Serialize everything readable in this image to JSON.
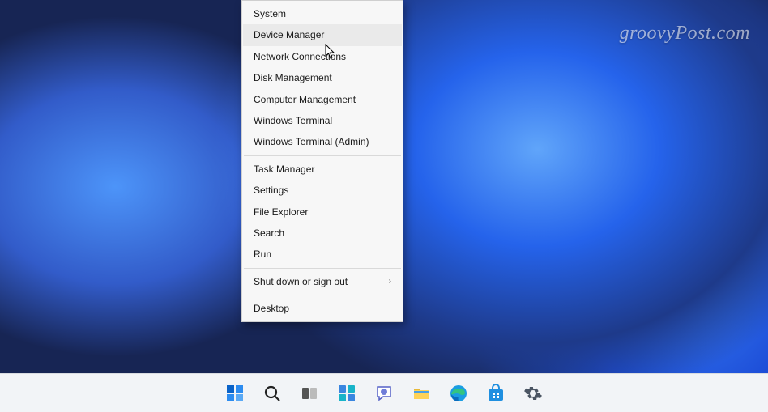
{
  "watermark": "groovyPost.com",
  "contextMenu": {
    "hoveredIndex": 1,
    "groups": [
      [
        {
          "label": "System",
          "submenu": false
        },
        {
          "label": "Device Manager",
          "submenu": false
        },
        {
          "label": "Network Connections",
          "submenu": false
        },
        {
          "label": "Disk Management",
          "submenu": false
        },
        {
          "label": "Computer Management",
          "submenu": false
        },
        {
          "label": "Windows Terminal",
          "submenu": false
        },
        {
          "label": "Windows Terminal (Admin)",
          "submenu": false
        }
      ],
      [
        {
          "label": "Task Manager",
          "submenu": false
        },
        {
          "label": "Settings",
          "submenu": false
        },
        {
          "label": "File Explorer",
          "submenu": false
        },
        {
          "label": "Search",
          "submenu": false
        },
        {
          "label": "Run",
          "submenu": false
        }
      ],
      [
        {
          "label": "Shut down or sign out",
          "submenu": true
        }
      ],
      [
        {
          "label": "Desktop",
          "submenu": false
        }
      ]
    ]
  },
  "taskbar": {
    "items": [
      {
        "name": "start-icon"
      },
      {
        "name": "search-icon"
      },
      {
        "name": "task-view-icon"
      },
      {
        "name": "widgets-icon"
      },
      {
        "name": "chat-icon"
      },
      {
        "name": "file-explorer-icon"
      },
      {
        "name": "edge-icon"
      },
      {
        "name": "store-icon"
      },
      {
        "name": "settings-icon"
      }
    ]
  }
}
